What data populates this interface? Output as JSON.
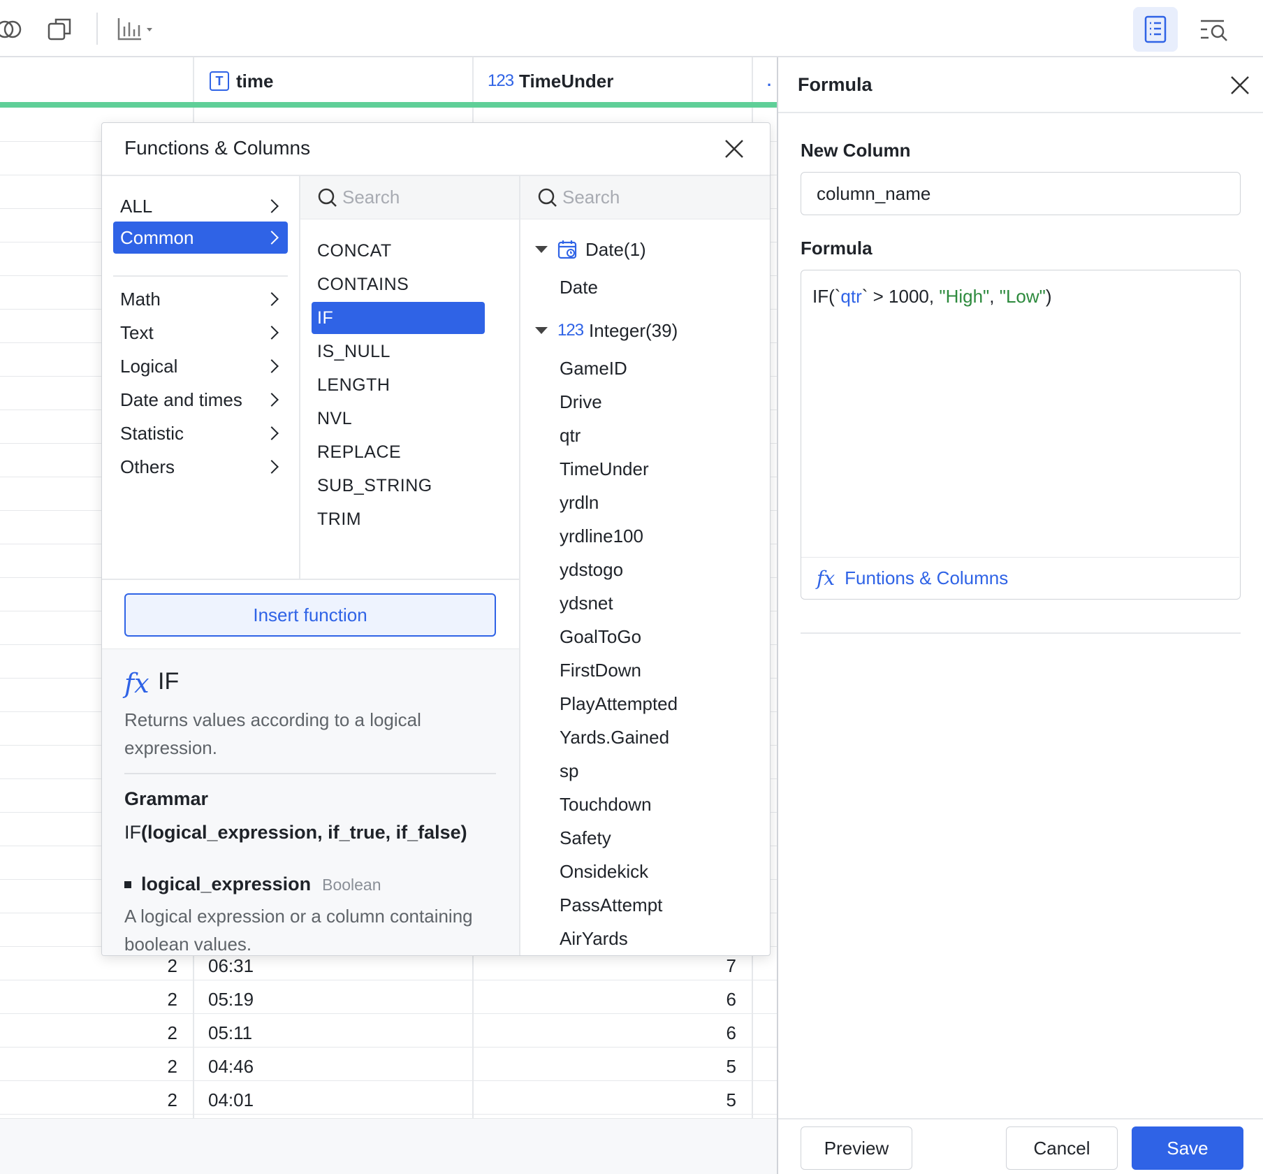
{
  "toolbar": {
    "icons": [
      "toggle-icon",
      "duplicate-icon",
      "chart-icon",
      "list-view-icon",
      "search-list-icon"
    ]
  },
  "grid": {
    "columns": [
      {
        "name": "time",
        "type_badge": "T"
      },
      {
        "name": "TimeUnder",
        "type_badge": "123"
      }
    ],
    "rows": [
      {
        "qtr": "2",
        "time": "06:31",
        "time_under": "7"
      },
      {
        "qtr": "2",
        "time": "05:19",
        "time_under": "6"
      },
      {
        "qtr": "2",
        "time": "05:11",
        "time_under": "6"
      },
      {
        "qtr": "2",
        "time": "04:46",
        "time_under": "5"
      },
      {
        "qtr": "2",
        "time": "04:01",
        "time_under": "5"
      }
    ]
  },
  "popup": {
    "title": "Functions & Columns",
    "categories": [
      {
        "label": "ALL"
      },
      {
        "label": "Common"
      },
      {
        "label": "Math"
      },
      {
        "label": "Text"
      },
      {
        "label": "Logical"
      },
      {
        "label": "Date and times"
      },
      {
        "label": "Statistic"
      },
      {
        "label": "Others"
      }
    ],
    "selected_category": "Common",
    "fn_search_placeholder": "Search",
    "col_search_placeholder": "Search",
    "functions": [
      "CONCAT",
      "CONTAINS",
      "IF",
      "IS_NULL",
      "LENGTH",
      "NVL",
      "REPLACE",
      "SUB_STRING",
      "TRIM"
    ],
    "selected_function": "IF",
    "column_groups": [
      {
        "label": "Date(1)",
        "icon": "calendar-icon",
        "items": [
          "Date"
        ]
      },
      {
        "label": "Integer(39)",
        "icon": "123",
        "items": [
          "GameID",
          "Drive",
          "qtr",
          "TimeUnder",
          "yrdln",
          "yrdline100",
          "ydstogo",
          "ydsnet",
          "GoalToGo",
          "FirstDown",
          "PlayAttempted",
          "Yards.Gained",
          "sp",
          "Touchdown",
          "Safety",
          "Onsidekick",
          "PassAttempt",
          "AirYards"
        ]
      }
    ],
    "insert_label": "Insert function",
    "detail": {
      "fx": "fx",
      "name": "IF",
      "description": "Returns values according to a logical expression.",
      "grammar_title": "Grammar",
      "grammar_fn": "IF",
      "grammar_args": "(logical_expression, if_true, if_false)",
      "param_name": "logical_expression",
      "param_type": "Boolean",
      "param_desc": "A logical expression or a column containing boolean values."
    }
  },
  "panel": {
    "title": "Formula",
    "new_column_label": "New Column",
    "new_column_value": "column_name",
    "formula_label": "Formula",
    "formula_parts": {
      "p1": "IF(`",
      "col": "qtr",
      "p2": "` > 1000, ",
      "s1": "\"High\"",
      "p3": ", ",
      "s2": "\"Low\"",
      "p4": ")"
    },
    "fx": "fx",
    "functions_link": "Funtions & Columns",
    "preview_label": "Preview",
    "cancel_label": "Cancel",
    "save_label": "Save"
  },
  "colors": {
    "accent": "#2f63e6",
    "progress_bar": "#5fcf98",
    "string_literal": "#2d8a3d"
  }
}
